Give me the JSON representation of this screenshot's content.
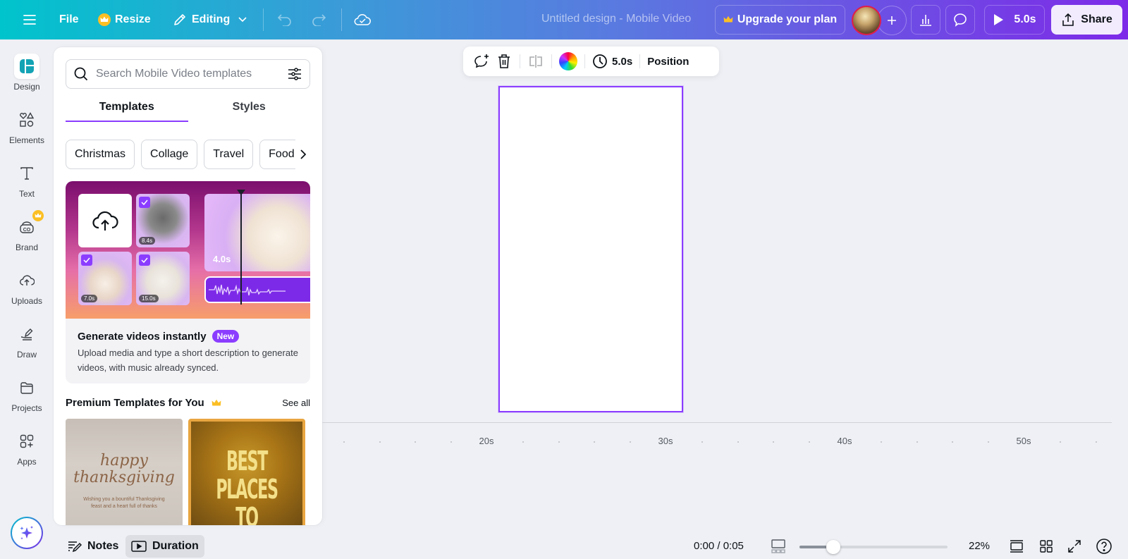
{
  "header": {
    "menu_icon": "hamburger-icon",
    "file_label": "File",
    "resize_label": "Resize",
    "editing_label": "Editing",
    "doc_title": "Untitled design - Mobile Video",
    "upgrade_label": "Upgrade your plan",
    "play_label": "5.0s",
    "share_label": "Share"
  },
  "rail": {
    "items": [
      {
        "label": "Design",
        "icon": "design-icon",
        "active": true
      },
      {
        "label": "Elements",
        "icon": "elements-icon"
      },
      {
        "label": "Text",
        "icon": "text-icon"
      },
      {
        "label": "Brand",
        "icon": "brand-icon",
        "badge": "crown"
      },
      {
        "label": "Uploads",
        "icon": "upload-cloud-icon"
      },
      {
        "label": "Draw",
        "icon": "draw-icon"
      },
      {
        "label": "Projects",
        "icon": "folder-icon"
      },
      {
        "label": "Apps",
        "icon": "apps-icon"
      }
    ]
  },
  "panel": {
    "search_placeholder": "Search Mobile Video templates",
    "tabs": [
      {
        "label": "Templates",
        "active": true
      },
      {
        "label": "Styles",
        "active": false
      }
    ],
    "chips": [
      "Christmas",
      "Collage",
      "Travel",
      "Food"
    ],
    "promo": {
      "tile_durations": [
        "8.4s",
        "7.0s",
        "15.0s"
      ],
      "big_tile_duration": "4.0s",
      "title": "Generate videos instantly",
      "badge": "New",
      "description": "Upload media and type a short description to generate videos, with music already synced."
    },
    "premium": {
      "title": "Premium Templates for You",
      "see_all": "See all",
      "templates": [
        {
          "script_line1": "happy",
          "script_line2": "thanksgiving",
          "caption": "Wishing you a bountiful Thanksgiving feast and a heart full of thanks"
        },
        {
          "headline": "BEST PLACES TO"
        }
      ]
    }
  },
  "context_toolbar": {
    "duration_label": "5.0s",
    "position_label": "Position"
  },
  "timeline": {
    "tick_labels": [
      "20s",
      "30s",
      "40s",
      "50s"
    ]
  },
  "bottom": {
    "notes_label": "Notes",
    "duration_label": "Duration",
    "time_readout": "0:00 / 0:05",
    "zoom_percent": 22,
    "zoom_label": "22%",
    "zoom_slider_fraction": 0.23
  },
  "colors": {
    "accent": "#8b3dff",
    "header_start": "#00c4cc",
    "header_end": "#7d2ae8",
    "crown": "#fbbf24"
  }
}
